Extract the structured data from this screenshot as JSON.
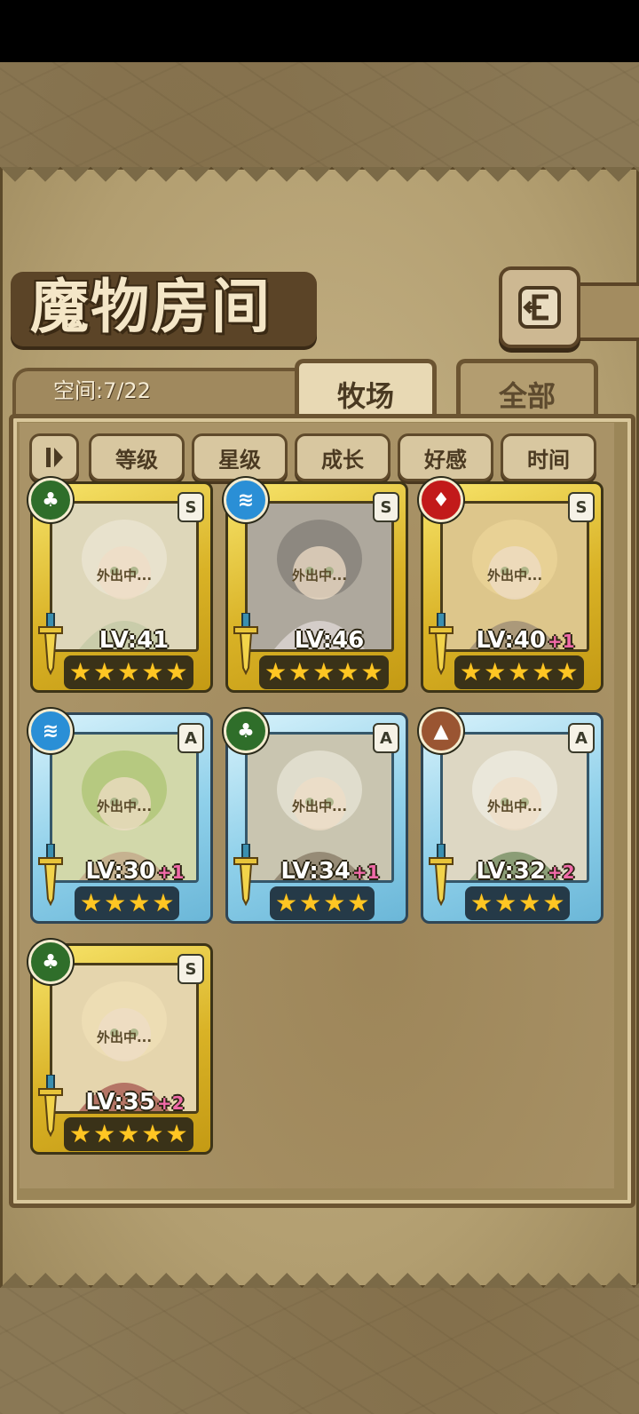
{
  "title": "魔物房间",
  "space_label": "空间:7/22",
  "tabs": [
    {
      "label": "牧场",
      "active": true
    },
    {
      "label": "全部",
      "active": false
    }
  ],
  "sort_buttons": [
    "等级",
    "星级",
    "成长",
    "好感",
    "时间"
  ],
  "away_text": "外出中...",
  "monsters": [
    {
      "element": "grass",
      "rank": "S",
      "level": "LV:41",
      "plus": "",
      "stars": 5
    },
    {
      "element": "water",
      "rank": "S",
      "level": "LV:46",
      "plus": "",
      "stars": 5
    },
    {
      "element": "fire",
      "rank": "S",
      "level": "LV:40",
      "plus": "+1",
      "stars": 5
    },
    {
      "element": "water",
      "rank": "A",
      "level": "LV:30",
      "plus": "+1",
      "stars": 4
    },
    {
      "element": "grass",
      "rank": "A",
      "level": "LV:34",
      "plus": "+1",
      "stars": 4
    },
    {
      "element": "earth",
      "rank": "A",
      "level": "LV:32",
      "plus": "+2",
      "stars": 4
    },
    {
      "element": "grass",
      "rank": "S",
      "level": "LV:35",
      "plus": "+2",
      "stars": 5
    }
  ],
  "colors": {
    "gold_frame": "#e5c53a",
    "blue_frame": "#8fd0ea",
    "plus_text": "#f06aa8"
  }
}
